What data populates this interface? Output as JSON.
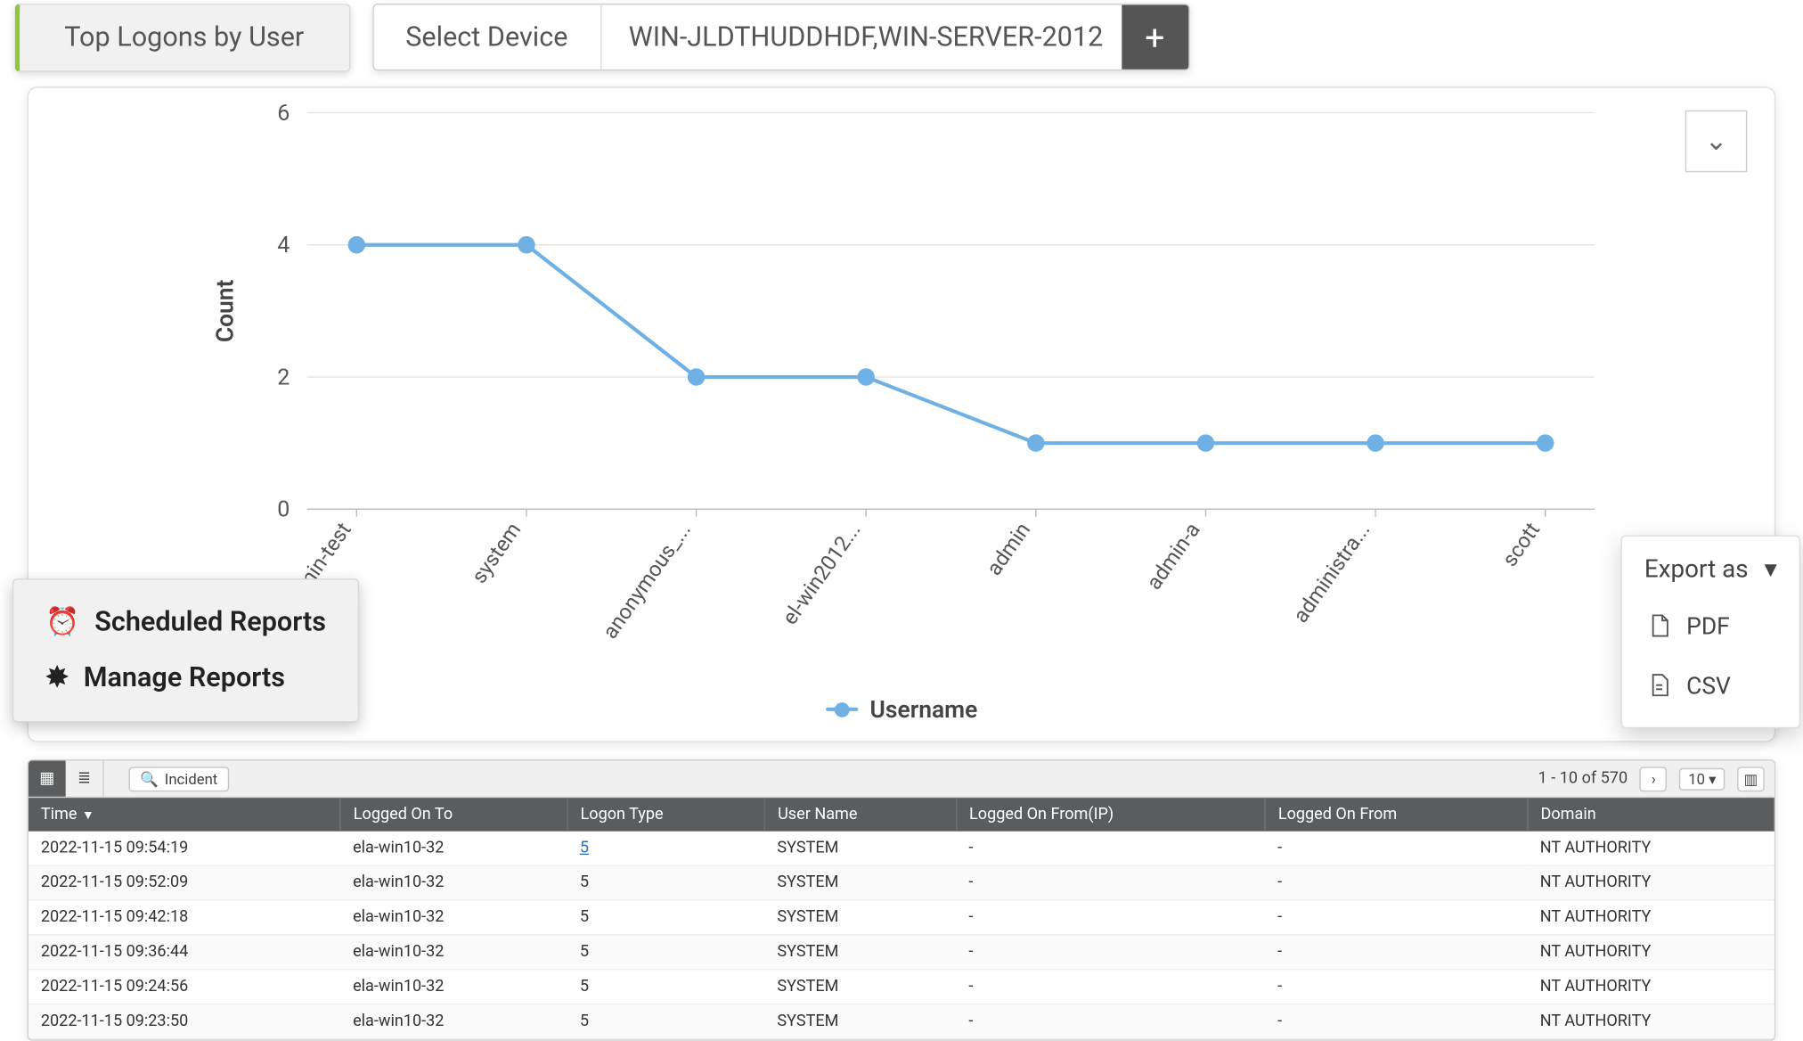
{
  "header": {
    "title": "Top Logons by User",
    "select_device_label": "Select Device",
    "device_value": "WIN-JLDTHUDDHDF,WIN-SERVER-2012"
  },
  "chart_data": {
    "type": "line",
    "categories": [
      "admin-test",
      "system",
      "anonymous_...",
      "el-win2012...",
      "admin",
      "admin-a",
      "administra...",
      "scott"
    ],
    "values": [
      4,
      4,
      2,
      2,
      1,
      1,
      1,
      1
    ],
    "title": "",
    "xlabel": "Username",
    "ylabel": "Count",
    "ylim": [
      0,
      6
    ],
    "yticks": [
      0,
      2,
      4,
      6
    ],
    "legend": "Username",
    "color": "#6fb1e4"
  },
  "reports_menu": {
    "scheduled_label": "Scheduled Reports",
    "manage_label": "Manage Reports"
  },
  "export_menu": {
    "label": "Export as",
    "pdf_label": "PDF",
    "csv_label": "CSV"
  },
  "table": {
    "incident_label": "Incident",
    "pagination_text": "1 - 10 of 570",
    "page_size": "10",
    "columns": [
      "Time",
      "Logged On To",
      "Logon Type",
      "User Name",
      "Logged On From(IP)",
      "Logged On From",
      "Domain"
    ],
    "rows": [
      {
        "time": "2022-11-15 09:54:19",
        "logged_on_to": "ela-win10-32",
        "logon_type": "5",
        "logon_type_link": true,
        "user_name": "SYSTEM",
        "from_ip": "-",
        "from": "-",
        "domain": "NT AUTHORITY"
      },
      {
        "time": "2022-11-15 09:52:09",
        "logged_on_to": "ela-win10-32",
        "logon_type": "5",
        "user_name": "SYSTEM",
        "from_ip": "-",
        "from": "-",
        "domain": "NT AUTHORITY"
      },
      {
        "time": "2022-11-15 09:42:18",
        "logged_on_to": "ela-win10-32",
        "logon_type": "5",
        "user_name": "SYSTEM",
        "from_ip": "-",
        "from": "-",
        "domain": "NT AUTHORITY"
      },
      {
        "time": "2022-11-15 09:36:44",
        "logged_on_to": "ela-win10-32",
        "logon_type": "5",
        "user_name": "SYSTEM",
        "from_ip": "-",
        "from": "-",
        "domain": "NT AUTHORITY"
      },
      {
        "time": "2022-11-15 09:24:56",
        "logged_on_to": "ela-win10-32",
        "logon_type": "5",
        "user_name": "SYSTEM",
        "from_ip": "-",
        "from": "-",
        "domain": "NT AUTHORITY"
      },
      {
        "time": "2022-11-15 09:23:50",
        "logged_on_to": "ela-win10-32",
        "logon_type": "5",
        "user_name": "SYSTEM",
        "from_ip": "-",
        "from": "-",
        "domain": "NT AUTHORITY"
      }
    ]
  }
}
